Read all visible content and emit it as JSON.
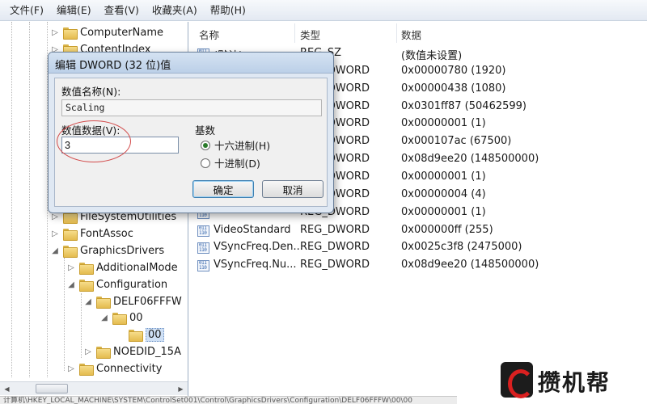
{
  "menubar": {
    "items": [
      "文件(F)",
      "编辑(E)",
      "查看(V)",
      "收藏夹(A)",
      "帮助(H)"
    ]
  },
  "tree": {
    "nodes": [
      {
        "label": "ComputerName",
        "expander": "▷"
      },
      {
        "label": "ContentIndex",
        "expander": "▷"
      },
      {
        "label": "FileSystemUtilities",
        "expander": "▷"
      },
      {
        "label": "FontAssoc",
        "expander": "▷"
      },
      {
        "label": "GraphicsDrivers",
        "expander": "◢"
      },
      {
        "label": "AdditionalMode",
        "expander": "▷"
      },
      {
        "label": "Configuration",
        "expander": "◢"
      },
      {
        "label": "DELF06FFFW",
        "expander": "◢"
      },
      {
        "label": "00",
        "expander": "◢"
      },
      {
        "label": "00",
        "expander": ""
      },
      {
        "label": "NOEDID_15A",
        "expander": "▷"
      },
      {
        "label": "Connectivity",
        "expander": "▷"
      }
    ]
  },
  "values": {
    "headers": {
      "name": "名称",
      "type": "类型",
      "data": "数据"
    },
    "rows": [
      {
        "name": "(默认)",
        "type": "REG_SZ",
        "data": "(数值未设置)"
      },
      {
        "name": "",
        "type": "REG_DWORD",
        "data": "0x00000780 (1920)"
      },
      {
        "name": "",
        "type": "REG_DWORD",
        "data": "0x00000438 (1080)"
      },
      {
        "name": "",
        "type": "REG_DWORD",
        "data": "0x0301ff87 (50462599)"
      },
      {
        "name": "",
        "type": "REG_DWORD",
        "data": "0x00000001 (1)"
      },
      {
        "name": "",
        "type": "REG_DWORD",
        "data": "0x000107ac (67500)"
      },
      {
        "name": "",
        "type": "REG_DWORD",
        "data": "0x08d9ee20 (148500000)"
      },
      {
        "name": "",
        "type": "REG_DWORD",
        "data": "0x00000001 (1)"
      },
      {
        "name": "",
        "type": "REG_DWORD",
        "data": "0x00000004 (4)"
      },
      {
        "name": "",
        "type": "REG_DWORD",
        "data": "0x00000001 (1)"
      },
      {
        "name": "VideoStandard",
        "type": "REG_DWORD",
        "data": "0x000000ff (255)"
      },
      {
        "name": "VSyncFreq.Den...",
        "type": "REG_DWORD",
        "data": "0x0025c3f8 (2475000)"
      },
      {
        "name": "VSyncFreq.Nu...",
        "type": "REG_DWORD",
        "data": "0x08d9ee20 (148500000)"
      }
    ]
  },
  "dialog": {
    "title": "编辑 DWORD (32 位)值",
    "value_name_label": "数值名称(N):",
    "value_name": "Scaling",
    "value_data_label": "数值数据(V):",
    "value_data": "3",
    "base_label": "基数",
    "radio_hex": "十六进制(H)",
    "radio_dec": "十进制(D)",
    "hex_checked": true,
    "ok_label": "确定",
    "cancel_label": "取消"
  },
  "statusbar": {
    "text": "计算机\\HKEY_LOCAL_MACHINE\\SYSTEM\\ControlSet001\\Control\\GraphicsDrivers\\Configuration\\DELF06FFFW\\00\\00"
  },
  "watermark": {
    "text": "攒机帮"
  }
}
